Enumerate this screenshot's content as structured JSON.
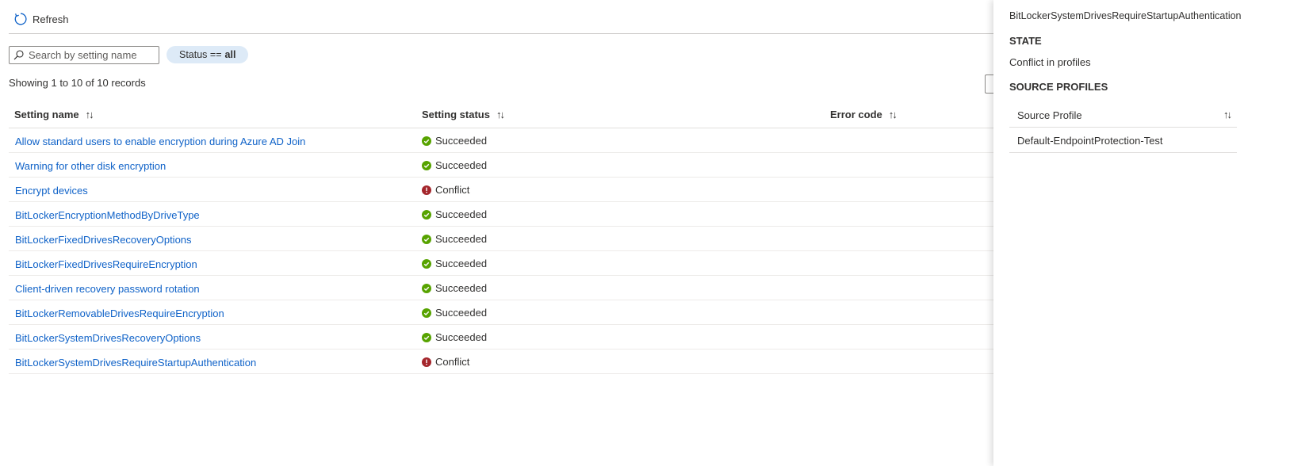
{
  "toolbar": {
    "refresh_label": "Refresh",
    "refresh_icon": "refresh-icon"
  },
  "filters": {
    "search_placeholder": "Search by setting name",
    "status_pill_prefix": "Status ==",
    "status_pill_value": "all"
  },
  "records_text": "Showing 1 to 10 of 10 records",
  "table": {
    "columns": [
      "Setting name",
      "Setting status",
      "Error code"
    ],
    "sort_glyph": "↑↓",
    "rows": [
      {
        "name": "Allow standard users to enable encryption during Azure AD Join",
        "status": "Succeeded"
      },
      {
        "name": "Warning for other disk encryption",
        "status": "Succeeded"
      },
      {
        "name": "Encrypt devices",
        "status": "Conflict"
      },
      {
        "name": "BitLockerEncryptionMethodByDriveType",
        "status": "Succeeded"
      },
      {
        "name": "BitLockerFixedDrivesRecoveryOptions",
        "status": "Succeeded"
      },
      {
        "name": "BitLockerFixedDrivesRequireEncryption",
        "status": "Succeeded"
      },
      {
        "name": "Client-driven recovery password rotation",
        "status": "Succeeded"
      },
      {
        "name": "BitLockerRemovableDrivesRequireEncryption",
        "status": "Succeeded"
      },
      {
        "name": "BitLockerSystemDrivesRecoveryOptions",
        "status": "Succeeded"
      },
      {
        "name": "BitLockerSystemDrivesRequireStartupAuthentication",
        "status": "Conflict"
      }
    ]
  },
  "panel": {
    "title": "BitLockerSystemDrivesRequireStartupAuthentication",
    "state_heading": "STATE",
    "state_value": "Conflict in profiles",
    "source_heading": "SOURCE PROFILES",
    "source_column": "Source Profile",
    "source_rows": [
      "Default-EndpointProtection-Test"
    ]
  },
  "colors": {
    "link": "#0f62c8",
    "success": "#57a300",
    "conflict": "#a4262c",
    "pill_bg": "#ddeaf7"
  }
}
